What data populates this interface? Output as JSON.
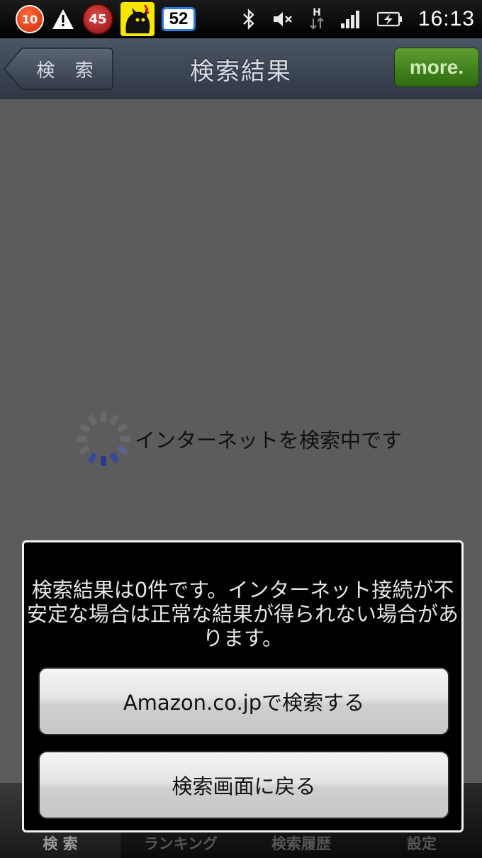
{
  "status_bar": {
    "notification_count": "10",
    "temperature": "45",
    "battery_widget_value": "52",
    "time": "16:13",
    "network_type": "H"
  },
  "title_bar": {
    "back_label": "検 索",
    "title": "検索結果",
    "more_label": "more."
  },
  "loading": {
    "text": "インターネットを検索中です"
  },
  "dialog": {
    "message": "検索結果は0件です。インターネット接続が不安定な場合は正常な結果が得られない場合があります。",
    "buttons": [
      {
        "label": "Amazon.co.jpで検索する"
      },
      {
        "label": "検索画面に戻る"
      }
    ]
  },
  "tab_bar": {
    "tabs": [
      {
        "label": "検 索",
        "active": true
      },
      {
        "label": "ランキング",
        "active": false
      },
      {
        "label": "検索履歴",
        "active": false
      },
      {
        "label": "設定",
        "active": false
      }
    ]
  },
  "colors": {
    "title_bar": "#3d4653",
    "more_button": "#4a8a22",
    "content_bg": "#5c5c5c",
    "spinner_active": "#2b3a8f"
  },
  "icons": {
    "warning": "warning-icon",
    "bluetooth": "bluetooth-icon",
    "mute": "volume-mute-icon",
    "signal": "signal-icon",
    "battery": "battery-charging-icon"
  }
}
